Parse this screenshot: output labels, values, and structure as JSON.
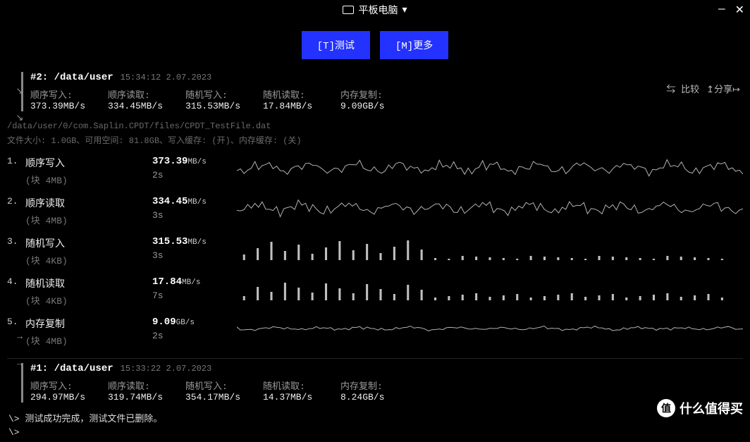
{
  "titlebar": {
    "device_label": "平板电脑"
  },
  "buttons": {
    "test": "[T]测试",
    "more": "[M]更多"
  },
  "actions": {
    "compare": "比较",
    "share": "分享"
  },
  "run2": {
    "id": "#2:",
    "path": "/data/user",
    "timestamp": "15:34:12 2.07.2023",
    "labels": {
      "seq_write": "顺序写入:",
      "seq_read": "顺序读取:",
      "rand_write": "随机写入:",
      "rand_read": "随机读取:",
      "mem_copy": "内存复制:"
    },
    "values": {
      "seq_write": "373.39MB/s",
      "seq_read": "334.45MB/s",
      "rand_write": "315.53MB/s",
      "rand_read": "17.84MB/s",
      "mem_copy": "9.09GB/s"
    }
  },
  "file_path": "/data/user/0/com.Saplin.CPDT/files/CPDT_TestFile.dat",
  "file_meta": "文件大小: 1.0GB、可用空间: 81.8GB、写入缓存: (开)、内存缓存: (关)",
  "tests": [
    {
      "num": "1.",
      "name": "顺序写入",
      "block": "(块 4MB)",
      "value": "373.39",
      "unit": "MB/s",
      "duration": "2s",
      "graph_type": "wave"
    },
    {
      "num": "2.",
      "name": "顺序读取",
      "block": "(块 4MB)",
      "value": "334.45",
      "unit": "MB/s",
      "duration": "3s",
      "graph_type": "wave"
    },
    {
      "num": "3.",
      "name": "随机写入",
      "block": "(块 4KB)",
      "value": "315.53",
      "unit": "MB/s",
      "duration": "3s",
      "graph_type": "bars"
    },
    {
      "num": "4.",
      "name": "随机读取",
      "block": "(块 4KB)",
      "value": "17.84",
      "unit": "MB/s",
      "duration": "7s",
      "graph_type": "bars_low"
    },
    {
      "num": "5.",
      "name": "内存复制",
      "block": "(块 4MB)",
      "value": "9.09",
      "unit": "GB/s",
      "duration": "2s",
      "graph_type": "wave_flat"
    }
  ],
  "run1": {
    "id": "#1:",
    "path": "/data/user",
    "timestamp": "15:33:22 2.07.2023",
    "labels": {
      "seq_write": "顺序写入:",
      "seq_read": "顺序读取:",
      "rand_write": "随机写入:",
      "rand_read": "随机读取:",
      "mem_copy": "内存复制:"
    },
    "values": {
      "seq_write": "294.97MB/s",
      "seq_read": "319.74MB/s",
      "rand_write": "354.17MB/s",
      "rand_read": "14.37MB/s",
      "mem_copy": "8.24GB/s"
    }
  },
  "status1": "\\> 测试成功完成，测试文件已删除。",
  "status2": "\\>",
  "watermark": "什么值得买",
  "watermark_badge": "值"
}
